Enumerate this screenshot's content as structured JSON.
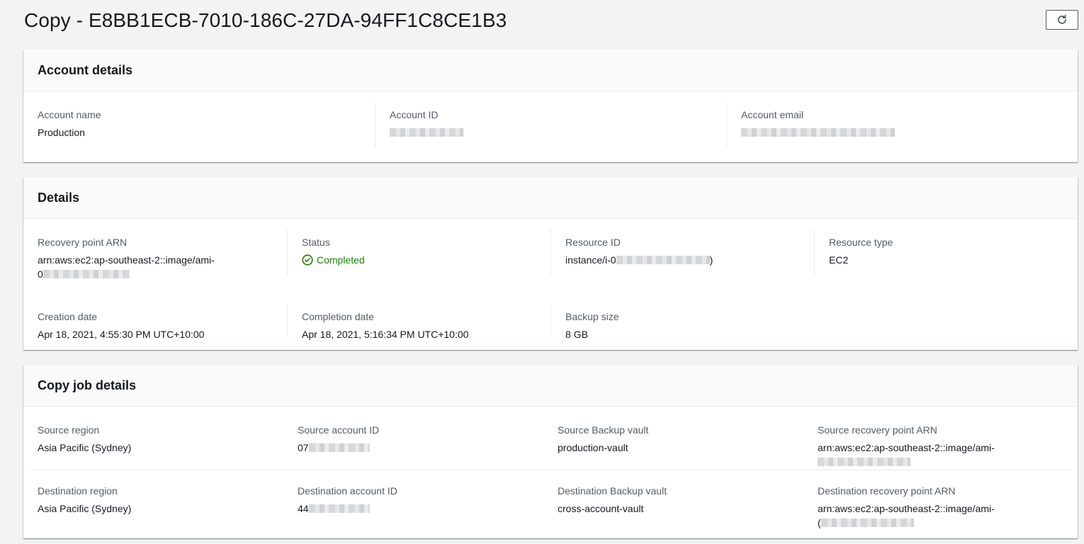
{
  "page": {
    "title": "Copy - E8BB1ECB-7010-186C-27DA-94FF1C8CE1B3",
    "refresh_icon": "refresh-icon"
  },
  "account_details": {
    "title": "Account details",
    "name_label": "Account name",
    "name_value": "Production",
    "id_label": "Account ID",
    "email_label": "Account email"
  },
  "details": {
    "title": "Details",
    "arn_label": "Recovery point ARN",
    "arn_value": "arn:aws:ec2:ap-southeast-2::image/ami-",
    "arn_value_line2": "0",
    "status_label": "Status",
    "status_value": "Completed",
    "status_icon": "check-circle-icon",
    "status_color": "#1d8102",
    "resource_id_label": "Resource ID",
    "resource_id_value": "instance/i-0",
    "resource_id_suffix": ")",
    "resource_type_label": "Resource type",
    "resource_type_value": "EC2",
    "creation_label": "Creation date",
    "creation_value": "Apr 18, 2021, 4:55:30 PM UTC+10:00",
    "completion_label": "Completion date",
    "completion_value": "Apr 18, 2021, 5:16:34 PM UTC+10:00",
    "size_label": "Backup size",
    "size_value": "8 GB"
  },
  "copy_job": {
    "title": "Copy job details",
    "source_region_label": "Source region",
    "source_region_value": "Asia Pacific (Sydney)",
    "source_account_label": "Source account ID",
    "source_account_prefix": "07",
    "source_vault_label": "Source Backup vault",
    "source_vault_value": "production-vault",
    "source_arn_label": "Source recovery point ARN",
    "source_arn_value": "arn:aws:ec2:ap-southeast-2::image/ami-",
    "dest_region_label": "Destination region",
    "dest_region_value": "Asia Pacific (Sydney)",
    "dest_account_label": "Destination account ID",
    "dest_account_prefix": "44",
    "dest_vault_label": "Destination Backup vault",
    "dest_vault_value": "cross-account-vault",
    "dest_arn_label": "Destination recovery point ARN",
    "dest_arn_value": "arn:aws:ec2:ap-southeast-2::image/ami-",
    "dest_arn_value_line2": "("
  }
}
